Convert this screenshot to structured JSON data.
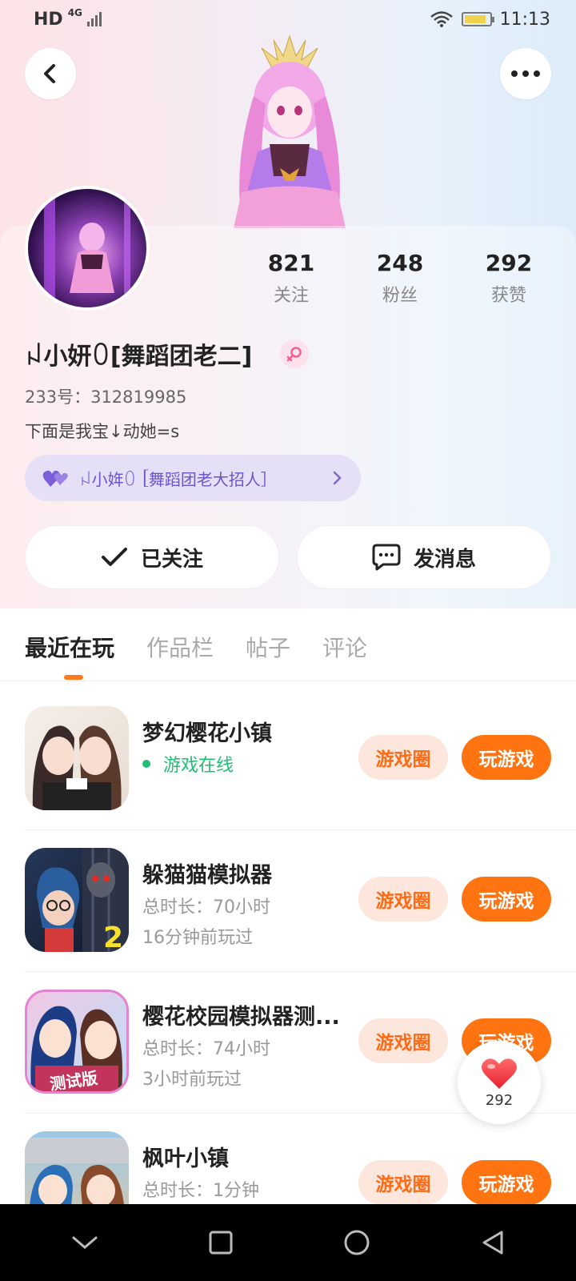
{
  "status_bar": {
    "network_hd": "HD",
    "network_type": "4G",
    "time": "11:13"
  },
  "profile": {
    "stats": [
      {
        "num": "821",
        "label": "关注"
      },
      {
        "num": "248",
        "label": "粉丝"
      },
      {
        "num": "292",
        "label": "获赞"
      }
    ],
    "username": "ꈤ小妍ꄲ[舞蹈团老二]",
    "uid": "233号：312819985",
    "bio": "下面是我宝↓动她=s",
    "group_label": "ꈤ小姩ꄲ［舞蹈团老大招人］"
  },
  "actions": {
    "follow_label": "已关注",
    "message_label": "发消息"
  },
  "tabs": [
    {
      "label": "最近在玩",
      "active": true
    },
    {
      "label": "作品栏",
      "active": false
    },
    {
      "label": "帖子",
      "active": false
    },
    {
      "label": "评论",
      "active": false
    }
  ],
  "games": [
    {
      "title": "梦幻樱花小镇",
      "sub1": "游戏在线",
      "sub2": "",
      "online": true
    },
    {
      "title": "躲猫猫模拟器",
      "sub1": "总时长：70小时",
      "sub2": "16分钟前玩过",
      "online": false
    },
    {
      "title": "樱花校园模拟器测...",
      "sub1": "总时长：74小时",
      "sub2": "3小时前玩过",
      "online": false
    },
    {
      "title": "枫叶小镇",
      "sub1": "总时长：1分钟",
      "sub2": "",
      "online": false
    }
  ],
  "game_buttons": {
    "circle_label": "游戏圈",
    "play_label": "玩游戏"
  },
  "like_float": {
    "count": "292"
  },
  "colors": {
    "accent": "#ff7310",
    "accent_light": "#fde7dc",
    "online_green": "#1fbf73",
    "group_purple": "#6b55c9"
  },
  "icons": {
    "back": "chevron-left-icon",
    "more": "more-dots-icon",
    "check": "check-icon",
    "message": "chat-bubble-icon",
    "heart": "heart-icon",
    "female": "female-icon",
    "nav_down": "chevron-down-icon",
    "nav_square": "square-icon",
    "nav_circle": "circle-icon",
    "nav_back": "triangle-back-icon"
  }
}
